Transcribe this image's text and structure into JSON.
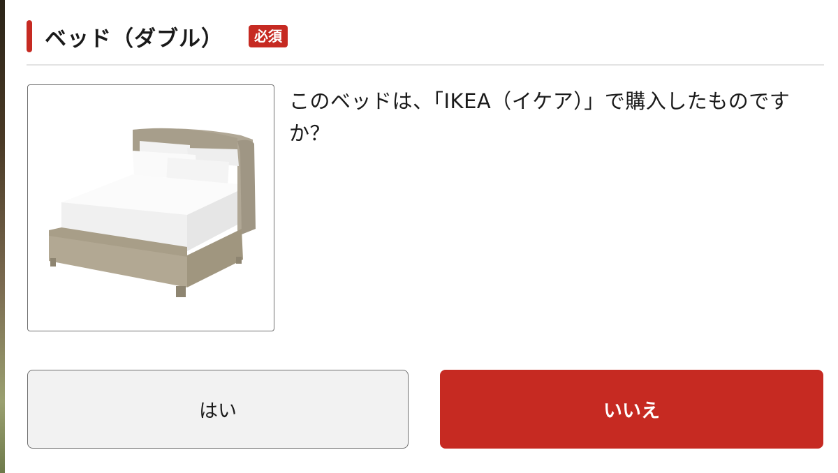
{
  "section": {
    "title": "ベッド（ダブル）",
    "required_badge": "必須"
  },
  "product": {
    "image_icon": "double-bed-icon"
  },
  "question": {
    "text": "このベッドは、「IKEA（イケア）」で購入したものですか？"
  },
  "buttons": {
    "yes_label": "はい",
    "no_label": "いいえ"
  },
  "colors": {
    "accent": "#c62a22",
    "button_neutral_bg": "#f2f2f2",
    "divider": "#e3e3e3"
  }
}
